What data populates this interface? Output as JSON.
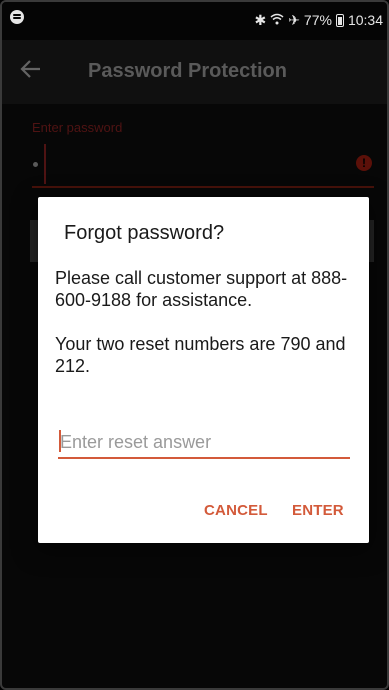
{
  "status_bar": {
    "battery": "77%",
    "time": "10:34",
    "icons": [
      "spotify-icon",
      "bluetooth-icon",
      "wifi-icon",
      "airplane-icon",
      "battery-icon"
    ]
  },
  "app_bar": {
    "title": "Password Protection"
  },
  "password_field": {
    "label": "Enter password",
    "value_masked": "•"
  },
  "dialog": {
    "title": "Forgot password?",
    "message_1": "Please call customer support at 888-600-9188 for assistance.",
    "message_2": "Your two reset numbers are 790 and 212.",
    "input_placeholder": "Enter reset answer",
    "input_value": "",
    "cancel_label": "CANCEL",
    "enter_label": "ENTER"
  },
  "colors": {
    "accent": "#d35a3a",
    "background": "#0b0b0b",
    "dialog": "#ffffff"
  }
}
